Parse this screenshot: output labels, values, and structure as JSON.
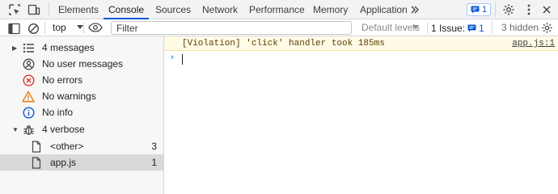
{
  "tabs": [
    {
      "label": "Elements"
    },
    {
      "label": "Console"
    },
    {
      "label": "Sources"
    },
    {
      "label": "Network"
    },
    {
      "label": "Performance"
    },
    {
      "label": "Memory"
    },
    {
      "label": "Application"
    }
  ],
  "active_tab": "Console",
  "more_tabs_icon": "chevron-double-right-icon",
  "issues_badge": {
    "count": "1"
  },
  "toolbar": {
    "context_label": "top",
    "filter_placeholder": "Filter",
    "levels_label": "Default levels",
    "issue_label": "1 Issue:",
    "issue_count": "1",
    "hidden_label": "3 hidden"
  },
  "sidebar": {
    "items": [
      {
        "label": "4 messages",
        "icon": "list-icon",
        "count": ""
      },
      {
        "label": "No user messages",
        "icon": "user-icon",
        "count": ""
      },
      {
        "label": "No errors",
        "icon": "error-icon",
        "count": ""
      },
      {
        "label": "No warnings",
        "icon": "warning-icon",
        "count": ""
      },
      {
        "label": "No info",
        "icon": "info-icon",
        "count": ""
      },
      {
        "label": "4 verbose",
        "icon": "bug-icon",
        "count": ""
      },
      {
        "label": "<other>",
        "icon": "file-icon",
        "count": "3"
      },
      {
        "label": "app.js",
        "icon": "file-icon",
        "count": "1"
      }
    ]
  },
  "console": {
    "violation_text": "[Violation] 'click' handler took 185ms",
    "violation_source": "app.js:1",
    "prompt_symbol": "›",
    "input_value": ""
  },
  "colors": {
    "accent": "#0b57d0",
    "error": "#dc362e",
    "warning": "#e37400",
    "violation_bg": "#fffbe5"
  }
}
